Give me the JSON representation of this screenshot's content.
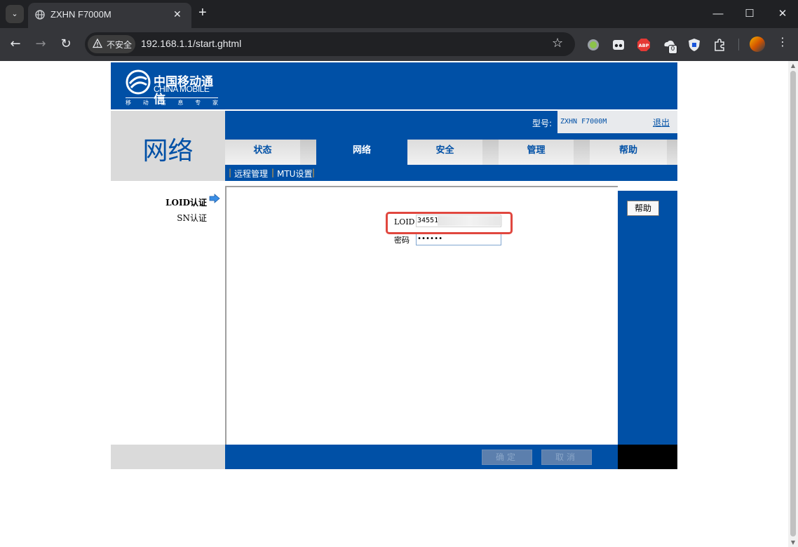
{
  "browser": {
    "tab_title": "ZXHN F7000M",
    "tab_close": "✕",
    "new_tab": "+",
    "security_label": "不安全",
    "url": "192.168.1.1/start.ghtml",
    "extension_badge": "0",
    "extension_abp": "ABP"
  },
  "header": {
    "logo_cn": "中国移动通信",
    "logo_en": "CHINA MOBILE",
    "logo_sub": [
      "移",
      "动",
      "信",
      "息",
      "专",
      "家"
    ]
  },
  "section_title": "网络",
  "topbar": {
    "model_label": "型号:",
    "model_value": "ZXHN F7000M",
    "logout": "退出"
  },
  "nav_tabs": [
    {
      "label": "状态",
      "active": false
    },
    {
      "label": "网络",
      "active": true
    },
    {
      "label": "安全",
      "active": false
    },
    {
      "label": "管理",
      "active": false
    },
    {
      "label": "帮助",
      "active": false
    }
  ],
  "sub_links": [
    "远程管理",
    "MTU设置"
  ],
  "sub_separator": "|",
  "sidebar": {
    "items": [
      {
        "label": "LOID认证",
        "active": true
      },
      {
        "label": "SN认证",
        "active": false
      }
    ]
  },
  "form": {
    "loid_label": "LOID",
    "loid_value": "34551",
    "password_label": "密码",
    "password_value": "••••••"
  },
  "help_button": "帮助",
  "footer": {
    "confirm": "确定",
    "cancel": "取消"
  },
  "colors": {
    "brand_blue": "#0050a6",
    "highlight_red": "#e0473f"
  }
}
